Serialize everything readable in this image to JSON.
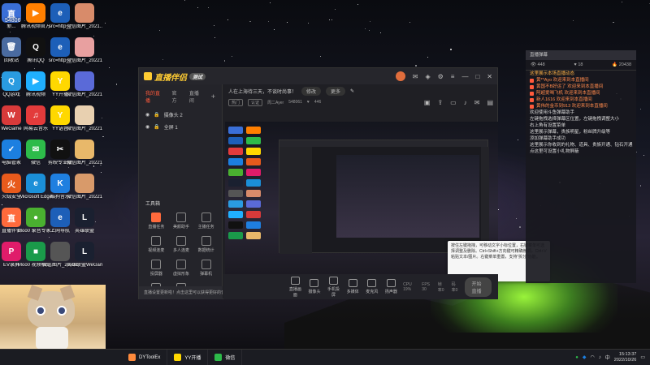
{
  "desktop_icons": [
    {
      "label": "新...",
      "color": "#3a6fd8",
      "glyph": "直"
    },
    {
      "label": "腾讯视频官方",
      "color": "#ff7f00",
      "glyph": "▶"
    },
    {
      "label": "src=http__",
      "color": "#1d5fb8",
      "glyph": "e"
    },
    {
      "label": "微信图片_2021...",
      "color": "#d88b6a",
      "glyph": ""
    },
    {
      "label": "回收站",
      "color": "#4a6ba0",
      "glyph": "🗑"
    },
    {
      "label": "腾讯QQ",
      "color": "#111",
      "glyph": "Q"
    },
    {
      "label": "src=http__",
      "color": "#1d5fb8",
      "glyph": "e"
    },
    {
      "label": "微信图片_2022101...",
      "color": "#e8a0a0",
      "glyph": ""
    },
    {
      "label": "QQ游戏",
      "color": "#2a9be0",
      "glyph": "Q"
    },
    {
      "label": "腾讯视频",
      "color": "#20b0ff",
      "glyph": "▶"
    },
    {
      "label": "YY开播",
      "color": "#ffd800",
      "glyph": "Y"
    },
    {
      "label": "微信图片_2022101...",
      "color": "#5a6ad8",
      "glyph": ""
    },
    {
      "label": "WeGame",
      "color": "#d83a3a",
      "glyph": "W"
    },
    {
      "label": "网易云音乐",
      "color": "#e33b3b",
      "glyph": "♫"
    },
    {
      "label": "YY语音",
      "color": "#ffd800",
      "glyph": "Y"
    },
    {
      "label": "微信图片_2022101...",
      "color": "#e8d0b0",
      "glyph": ""
    },
    {
      "label": "电脑管家",
      "color": "#1c7fe0",
      "glyph": "✓"
    },
    {
      "label": "微信",
      "color": "#2dbb4a",
      "glyph": "✉"
    },
    {
      "label": "剪映专业版",
      "color": "#111",
      "glyph": "✂"
    },
    {
      "label": "微信图片_2022101...",
      "color": "#e8b86a",
      "glyph": ""
    },
    {
      "label": "火绒安全",
      "color": "#e85a1c",
      "glyph": "火"
    },
    {
      "label": "Microsoft Edge",
      "color": "#1b8fd8",
      "glyph": "e"
    },
    {
      "label": "酷狗音乐",
      "color": "#1f7fe0",
      "glyph": "K"
    },
    {
      "label": "微信图片_2022101...",
      "color": "#d89a6a",
      "glyph": ""
    },
    {
      "label": "直播伴侣",
      "color": "#ff6a3c",
      "glyph": "直"
    },
    {
      "label": "Moo0 录音专家 1.43",
      "color": "#4ab030",
      "glyph": "●"
    },
    {
      "label": "上网导航",
      "color": "#1d5fb8",
      "glyph": "e"
    },
    {
      "label": "英雄联盟",
      "color": "#1a2030",
      "glyph": "L"
    },
    {
      "label": "EV录屏",
      "color": "#e01c6a",
      "glyph": "P"
    },
    {
      "label": "Moo0 视频格式 1.17",
      "color": "#1a9a4a",
      "glyph": "■"
    },
    {
      "label": "微信图片_2022101...",
      "color": "#555",
      "glyph": ""
    },
    {
      "label": "英雄联盟WeGame版",
      "color": "#1a2030",
      "glyph": "L"
    }
  ],
  "app": {
    "logo_text": "直播伴侣",
    "version_tag": "测试",
    "title": "人在上海待三天，不谈时尚事！",
    "title_pill_1": "修改",
    "title_pill_2": "更多",
    "stat_tag_1": "热门",
    "stat_tag_2": "认证",
    "stat_user": "周二Ayer",
    "stat_id": "548061",
    "stat_fans": "446",
    "left_tabs": [
      "我的直播",
      "官方",
      "直播间"
    ],
    "sources": [
      "摄像头 2",
      "全屏 1"
    ],
    "tools_title": "工具箱",
    "tools": [
      "直播任务",
      "美颜助手",
      "主播任务",
      "视频连麦",
      "多人连麦",
      "数据统计",
      "投屏器",
      "虚拟形象",
      "弹幕机",
      "互动",
      "更多",
      ""
    ],
    "left_footer": "直播设置更新啦！点击这里可以获得更好的音频",
    "bottom_buttons": [
      "直播画面",
      "摄像头",
      "手机投屏",
      "多媒体",
      "麦克风",
      "扬声器"
    ],
    "bottom_stats": [
      "CPU 19%",
      "FPS 30",
      "帧率0",
      "码率0"
    ],
    "start_button": "开始直播",
    "tooltip": "按住左键拖拽，可移动文字小标位置，右键菜单可选择调整及删除。Ctrl+Shift+方向键可精确微调，Ctrl+V粘贴文本/图片。右键菜单重置，支持“拆分”功能。"
  },
  "chat": {
    "header": "直播弹幕",
    "stats": [
      "448",
      "18",
      "20438"
    ],
    "messages": [
      {
        "type": "sys",
        "text": "这里展示本场直播动态"
      },
      {
        "type": "gift",
        "text": "黄**Ayo 欢迎来到本直播间"
      },
      {
        "type": "gift",
        "text": "黄国不B好运了 欢迎来到本直播间"
      },
      {
        "type": "gift",
        "text": "阿超爱喝飞机 欢迎来到本直播间"
      },
      {
        "type": "gift",
        "text": "新人1616 欢迎来到本直播间"
      },
      {
        "type": "gift",
        "text": "黄伟的金币到913 欢迎来到本直播间"
      },
      {
        "type": "msg",
        "text": ""
      },
      {
        "type": "msg",
        "text": "欢迎使用斗鱼弹幕助手"
      },
      {
        "type": "msg",
        "text": "左键拖拽选择弹幕区位置，左键拖拽调整大小"
      },
      {
        "type": "msg",
        "text": "右上角有设置菜单"
      },
      {
        "type": "msg",
        "text": "这里展示弹幕，贵族明星，粉丝牌升级等"
      },
      {
        "type": "msg",
        "text": "添加弹幕助手成功"
      },
      {
        "type": "msg",
        "text": ""
      },
      {
        "type": "msg",
        "text": ""
      },
      {
        "type": "msg",
        "text": ""
      },
      {
        "type": "msg",
        "text": ""
      },
      {
        "type": "msg",
        "text": ""
      },
      {
        "type": "msg",
        "text": ""
      },
      {
        "type": "msg",
        "text": ""
      },
      {
        "type": "msg",
        "text": "这里展示你收到的礼物、道具、贵族开通、钻石开通"
      },
      {
        "type": "msg",
        "text": "点这里可设置小礼物屏蔽"
      }
    ]
  },
  "taskbar": {
    "tasks": [
      {
        "label": "DYToolEx",
        "color": "#ff8a3c"
      },
      {
        "label": "YY开播",
        "color": "#ffd800"
      },
      {
        "label": "微信",
        "color": "#2dbb4a"
      }
    ],
    "tray_text": "中",
    "time": "15:13:37",
    "date": "2022/10/26"
  },
  "desktop_badge": "54806"
}
